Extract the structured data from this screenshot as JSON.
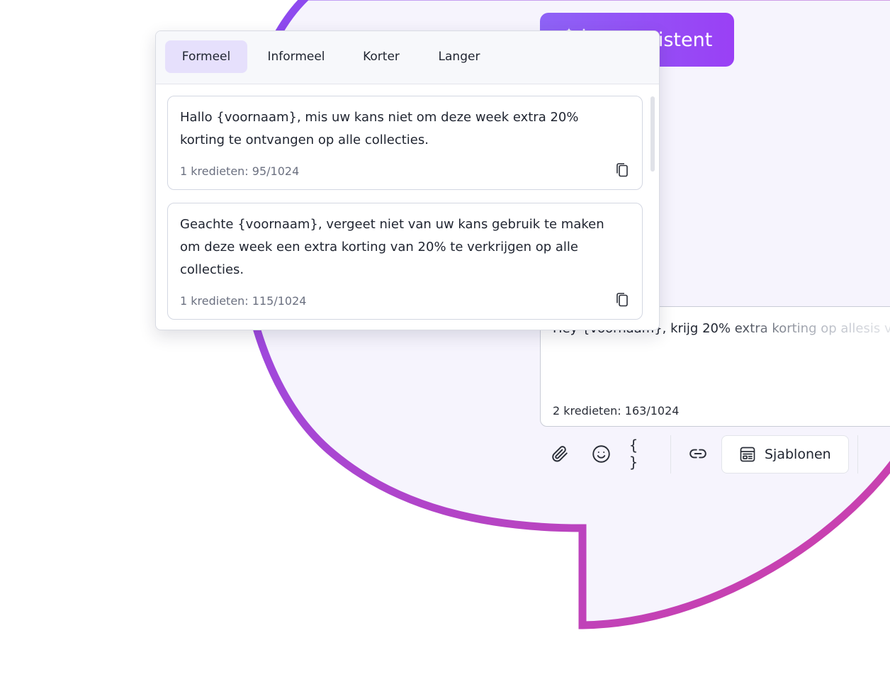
{
  "colors": {
    "accent_start": "#8e63f6",
    "accent_end": "#9a40f5",
    "ring_start": "#8a4bf3",
    "ring_end": "#d23fa5",
    "active_tab_bg": "#e6e0fc"
  },
  "ai_badge": {
    "label": "AI-assistent",
    "icon": "sparkles-icon"
  },
  "popup": {
    "tabs": [
      {
        "label": "Formeel",
        "active": true
      },
      {
        "label": "Informeel",
        "active": false
      },
      {
        "label": "Korter",
        "active": false
      },
      {
        "label": "Langer",
        "active": false
      }
    ],
    "suggestions": [
      {
        "text": "Hallo {voornaam}, mis uw kans niet om deze week extra 20% korting te ontvangen op alle collecties.",
        "credits": "1 kredieten: 95/1024",
        "copy_icon": "copy-icon"
      },
      {
        "text": "Geachte {voornaam}, vergeet niet van uw kans gebruik te maken om deze week een extra korting van 20% te verkrijgen op alle collecties.",
        "credits": "1 kredieten: 115/1024",
        "copy_icon": "copy-icon"
      }
    ]
  },
  "composer": {
    "text": "Hey {voornaam}, krijg 20% extra korting op allesis v",
    "credits": "2 kredieten: 163/1024"
  },
  "toolbar": {
    "icons": [
      "paperclip-icon",
      "smiley-icon",
      "variable-braces-icon",
      "link-icon"
    ],
    "braces_glyph": "{ }",
    "templates_label": "Sjablonen",
    "templates_icon": "template-icon"
  }
}
